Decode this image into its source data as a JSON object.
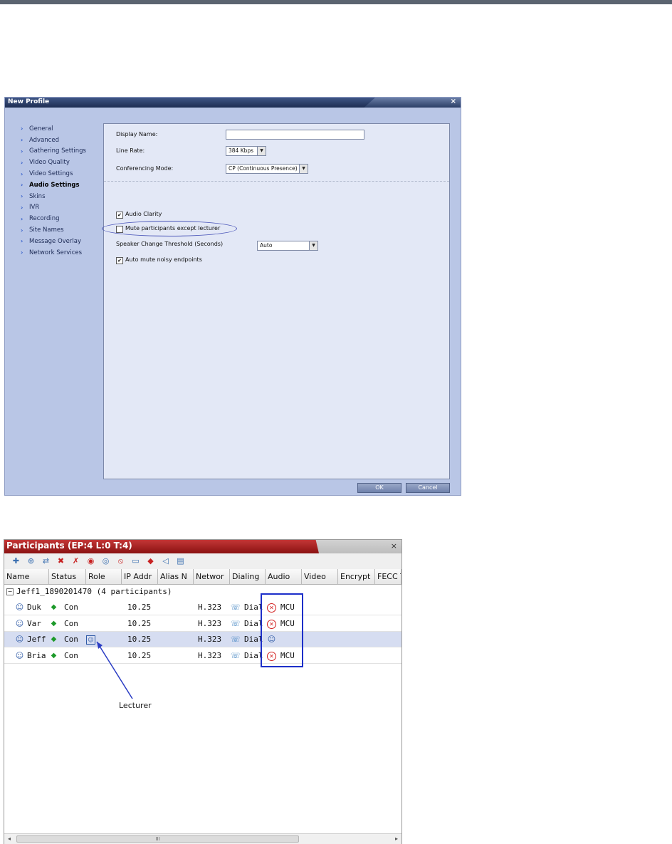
{
  "dialog": {
    "title": "New Profile",
    "close_glyph": "×",
    "nav": [
      {
        "label": "General"
      },
      {
        "label": "Advanced"
      },
      {
        "label": "Gathering Settings"
      },
      {
        "label": "Video Quality"
      },
      {
        "label": "Video Settings"
      },
      {
        "label": "Audio Settings",
        "active": true
      },
      {
        "label": "Skins"
      },
      {
        "label": "IVR"
      },
      {
        "label": "Recording"
      },
      {
        "label": "Site Names"
      },
      {
        "label": "Message Overlay"
      },
      {
        "label": "Network Services"
      }
    ],
    "fields": {
      "display_name_label": "Display Name:",
      "display_name_value": "",
      "line_rate_label": "Line Rate:",
      "line_rate_value": "384 Kbps",
      "conf_mode_label": "Conferencing Mode:",
      "conf_mode_value": "CP (Continuous Presence)"
    },
    "options": {
      "audio_clarity": {
        "label": "Audio Clarity",
        "checked": true
      },
      "mute_except_lecturer": {
        "label": "Mute participants except lecturer",
        "checked": false
      },
      "speaker_threshold_label": "Speaker Change Threshold (Seconds)",
      "speaker_threshold_value": "Auto",
      "auto_mute_noisy": {
        "label": "Auto mute noisy endpoints",
        "checked": true
      }
    },
    "ok_label": "OK",
    "cancel_label": "Cancel",
    "check_glyph": "✔"
  },
  "participants": {
    "title": "Participants (EP:4 L:0 T:4)",
    "close_glyph": "×",
    "toolbar_icons": [
      "add-participant-icon",
      "add-from-address-book-icon",
      "connect-icon",
      "disconnect-icon",
      "delete-participant-icon",
      "mute-audio-icon",
      "unmute-audio-icon",
      "suspend-video-icon",
      "resume-video-icon",
      "change-layout-icon",
      "volume-icon",
      "properties-icon"
    ],
    "columns": [
      "Name",
      "Status",
      "Role",
      "IP Addr",
      "Alias N",
      "Networ",
      "Dialing",
      "Audio",
      "Video",
      "Encrypt",
      "FECC T"
    ],
    "group": {
      "expander": "−",
      "label": "Jeff1_1890201470 (4  participants)"
    },
    "rows": [
      {
        "name": "Duk",
        "status": "Con",
        "role": "",
        "ip": "10.25",
        "network": "H.323",
        "dialing": "Dial",
        "audio": "MCU",
        "audio_icon": "muted-icon"
      },
      {
        "name": "Var",
        "status": "Con",
        "role": "",
        "ip": "10.25",
        "network": "H.323",
        "dialing": "Dial",
        "audio": "MCU",
        "audio_icon": "muted-icon"
      },
      {
        "name": "Jeff",
        "status": "Con",
        "role": "lecturer-icon",
        "ip": "10.25",
        "network": "H.323",
        "dialing": "Dial",
        "audio": "",
        "audio_icon": "speaking-icon",
        "selected": true
      },
      {
        "name": "Bria",
        "status": "Con",
        "role": "",
        "ip": "10.25",
        "network": "H.323",
        "dialing": "Dial",
        "audio": "MCU",
        "audio_icon": "muted-icon"
      }
    ],
    "annotation": "Lecturer",
    "scroll": {
      "left": "◂",
      "right": "▸",
      "grip": "III"
    },
    "colors": {
      "title_bar": "#a81f1f",
      "highlight_box": "#1d2fc9",
      "arrow": "#2a3cc4"
    }
  }
}
